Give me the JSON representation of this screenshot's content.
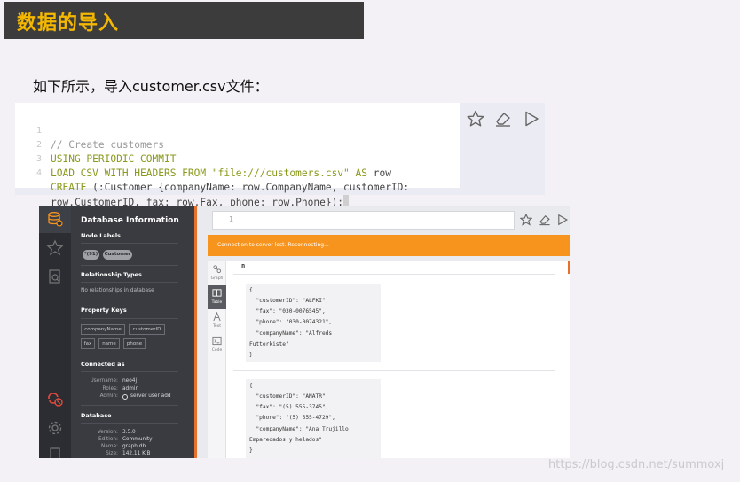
{
  "header": {
    "title": "数据的导入"
  },
  "intro": {
    "text": "如下所示，导入customer.csv文件："
  },
  "code_block": {
    "lines": [
      {
        "num": "1",
        "text": "// Create customers"
      },
      {
        "num": "2",
        "text": "USING PERIODIC COMMIT"
      },
      {
        "num": "3",
        "kw1": "LOAD CSV WITH HEADERS FROM ",
        "str": "\"file:///customers.csv\"",
        "kw2": " AS ",
        "rest": "row"
      },
      {
        "num": "4",
        "kw1": "CREATE",
        "rest": " (:Customer {companyName: row.CompanyName, customerID:"
      },
      {
        "num": "",
        "rest": "row.CustomerID, fax: row.Fax, phone: row.Phone});"
      }
    ],
    "actions": [
      "star-icon",
      "eraser-icon",
      "play-icon"
    ]
  },
  "screenshot": {
    "drawer": {
      "title": "Database Information",
      "node_labels": {
        "heading": "Node Labels",
        "pills": [
          "*(91)",
          "Customer"
        ]
      },
      "relationship_types": {
        "heading": "Relationship Types",
        "empty": "No relationships in database"
      },
      "property_keys": {
        "heading": "Property Keys",
        "keys": [
          "companyName",
          "customerID",
          "fax",
          "name",
          "phone"
        ]
      },
      "connected_as": {
        "heading": "Connected as",
        "username_label": "Username:",
        "username": "neo4j",
        "roles_label": "Roles:",
        "roles": "admin",
        "admin_label": "Admin:",
        "admin": "server user add"
      },
      "database": {
        "heading": "Database",
        "version_label": "Version:",
        "version": "3.5.0",
        "edition_label": "Edition:",
        "edition": "Community",
        "name_label": "Name:",
        "name": "graph.db",
        "size_label": "Size:",
        "size": "142.11 KiB"
      }
    },
    "editor": {
      "placeholder": "1"
    },
    "banner": "Connection to server lost. Reconnecting...",
    "tabs": [
      "Graph",
      "Table",
      "Text",
      "Code"
    ],
    "active_tab": "Table",
    "column": "n",
    "records": [
      {
        "lines": [
          "{",
          "  \"customerID\": \"ALFKI\",",
          "  \"fax\": \"030-0076545\",",
          "  \"phone\": \"030-0074321\",",
          "  \"companyName\": \"Alfreds",
          "Futterkiste\"",
          "}"
        ]
      },
      {
        "lines": [
          "{",
          "  \"customerID\": \"ANATR\",",
          "  \"fax\": \"(5) 555-3745\",",
          "  \"phone\": \"(5) 555-4729\",",
          "  \"companyName\": \"Ana Trujillo",
          "Emparedados y helados\"",
          "}"
        ]
      }
    ]
  },
  "watermark": "https://blog.csdn.net/summoxj",
  "colors": {
    "title_accent": "#f5b800",
    "banner": "#f7941d",
    "edge": "#e8702a"
  }
}
